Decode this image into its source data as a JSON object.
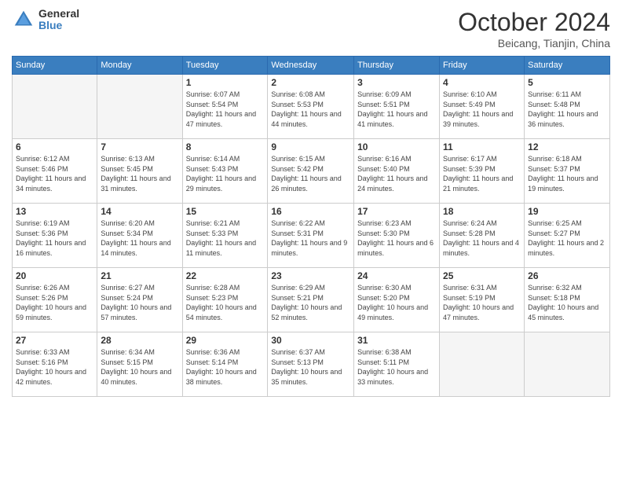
{
  "logo": {
    "general": "General",
    "blue": "Blue"
  },
  "title": "October 2024",
  "subtitle": "Beicang, Tianjin, China",
  "days_header": [
    "Sunday",
    "Monday",
    "Tuesday",
    "Wednesday",
    "Thursday",
    "Friday",
    "Saturday"
  ],
  "weeks": [
    [
      {
        "day": "",
        "sunrise": "",
        "sunset": "",
        "daylight": ""
      },
      {
        "day": "",
        "sunrise": "",
        "sunset": "",
        "daylight": ""
      },
      {
        "day": "1",
        "sunrise": "Sunrise: 6:07 AM",
        "sunset": "Sunset: 5:54 PM",
        "daylight": "Daylight: 11 hours and 47 minutes."
      },
      {
        "day": "2",
        "sunrise": "Sunrise: 6:08 AM",
        "sunset": "Sunset: 5:53 PM",
        "daylight": "Daylight: 11 hours and 44 minutes."
      },
      {
        "day": "3",
        "sunrise": "Sunrise: 6:09 AM",
        "sunset": "Sunset: 5:51 PM",
        "daylight": "Daylight: 11 hours and 41 minutes."
      },
      {
        "day": "4",
        "sunrise": "Sunrise: 6:10 AM",
        "sunset": "Sunset: 5:49 PM",
        "daylight": "Daylight: 11 hours and 39 minutes."
      },
      {
        "day": "5",
        "sunrise": "Sunrise: 6:11 AM",
        "sunset": "Sunset: 5:48 PM",
        "daylight": "Daylight: 11 hours and 36 minutes."
      }
    ],
    [
      {
        "day": "6",
        "sunrise": "Sunrise: 6:12 AM",
        "sunset": "Sunset: 5:46 PM",
        "daylight": "Daylight: 11 hours and 34 minutes."
      },
      {
        "day": "7",
        "sunrise": "Sunrise: 6:13 AM",
        "sunset": "Sunset: 5:45 PM",
        "daylight": "Daylight: 11 hours and 31 minutes."
      },
      {
        "day": "8",
        "sunrise": "Sunrise: 6:14 AM",
        "sunset": "Sunset: 5:43 PM",
        "daylight": "Daylight: 11 hours and 29 minutes."
      },
      {
        "day": "9",
        "sunrise": "Sunrise: 6:15 AM",
        "sunset": "Sunset: 5:42 PM",
        "daylight": "Daylight: 11 hours and 26 minutes."
      },
      {
        "day": "10",
        "sunrise": "Sunrise: 6:16 AM",
        "sunset": "Sunset: 5:40 PM",
        "daylight": "Daylight: 11 hours and 24 minutes."
      },
      {
        "day": "11",
        "sunrise": "Sunrise: 6:17 AM",
        "sunset": "Sunset: 5:39 PM",
        "daylight": "Daylight: 11 hours and 21 minutes."
      },
      {
        "day": "12",
        "sunrise": "Sunrise: 6:18 AM",
        "sunset": "Sunset: 5:37 PM",
        "daylight": "Daylight: 11 hours and 19 minutes."
      }
    ],
    [
      {
        "day": "13",
        "sunrise": "Sunrise: 6:19 AM",
        "sunset": "Sunset: 5:36 PM",
        "daylight": "Daylight: 11 hours and 16 minutes."
      },
      {
        "day": "14",
        "sunrise": "Sunrise: 6:20 AM",
        "sunset": "Sunset: 5:34 PM",
        "daylight": "Daylight: 11 hours and 14 minutes."
      },
      {
        "day": "15",
        "sunrise": "Sunrise: 6:21 AM",
        "sunset": "Sunset: 5:33 PM",
        "daylight": "Daylight: 11 hours and 11 minutes."
      },
      {
        "day": "16",
        "sunrise": "Sunrise: 6:22 AM",
        "sunset": "Sunset: 5:31 PM",
        "daylight": "Daylight: 11 hours and 9 minutes."
      },
      {
        "day": "17",
        "sunrise": "Sunrise: 6:23 AM",
        "sunset": "Sunset: 5:30 PM",
        "daylight": "Daylight: 11 hours and 6 minutes."
      },
      {
        "day": "18",
        "sunrise": "Sunrise: 6:24 AM",
        "sunset": "Sunset: 5:28 PM",
        "daylight": "Daylight: 11 hours and 4 minutes."
      },
      {
        "day": "19",
        "sunrise": "Sunrise: 6:25 AM",
        "sunset": "Sunset: 5:27 PM",
        "daylight": "Daylight: 11 hours and 2 minutes."
      }
    ],
    [
      {
        "day": "20",
        "sunrise": "Sunrise: 6:26 AM",
        "sunset": "Sunset: 5:26 PM",
        "daylight": "Daylight: 10 hours and 59 minutes."
      },
      {
        "day": "21",
        "sunrise": "Sunrise: 6:27 AM",
        "sunset": "Sunset: 5:24 PM",
        "daylight": "Daylight: 10 hours and 57 minutes."
      },
      {
        "day": "22",
        "sunrise": "Sunrise: 6:28 AM",
        "sunset": "Sunset: 5:23 PM",
        "daylight": "Daylight: 10 hours and 54 minutes."
      },
      {
        "day": "23",
        "sunrise": "Sunrise: 6:29 AM",
        "sunset": "Sunset: 5:21 PM",
        "daylight": "Daylight: 10 hours and 52 minutes."
      },
      {
        "day": "24",
        "sunrise": "Sunrise: 6:30 AM",
        "sunset": "Sunset: 5:20 PM",
        "daylight": "Daylight: 10 hours and 49 minutes."
      },
      {
        "day": "25",
        "sunrise": "Sunrise: 6:31 AM",
        "sunset": "Sunset: 5:19 PM",
        "daylight": "Daylight: 10 hours and 47 minutes."
      },
      {
        "day": "26",
        "sunrise": "Sunrise: 6:32 AM",
        "sunset": "Sunset: 5:18 PM",
        "daylight": "Daylight: 10 hours and 45 minutes."
      }
    ],
    [
      {
        "day": "27",
        "sunrise": "Sunrise: 6:33 AM",
        "sunset": "Sunset: 5:16 PM",
        "daylight": "Daylight: 10 hours and 42 minutes."
      },
      {
        "day": "28",
        "sunrise": "Sunrise: 6:34 AM",
        "sunset": "Sunset: 5:15 PM",
        "daylight": "Daylight: 10 hours and 40 minutes."
      },
      {
        "day": "29",
        "sunrise": "Sunrise: 6:36 AM",
        "sunset": "Sunset: 5:14 PM",
        "daylight": "Daylight: 10 hours and 38 minutes."
      },
      {
        "day": "30",
        "sunrise": "Sunrise: 6:37 AM",
        "sunset": "Sunset: 5:13 PM",
        "daylight": "Daylight: 10 hours and 35 minutes."
      },
      {
        "day": "31",
        "sunrise": "Sunrise: 6:38 AM",
        "sunset": "Sunset: 5:11 PM",
        "daylight": "Daylight: 10 hours and 33 minutes."
      },
      {
        "day": "",
        "sunrise": "",
        "sunset": "",
        "daylight": ""
      },
      {
        "day": "",
        "sunrise": "",
        "sunset": "",
        "daylight": ""
      }
    ]
  ]
}
